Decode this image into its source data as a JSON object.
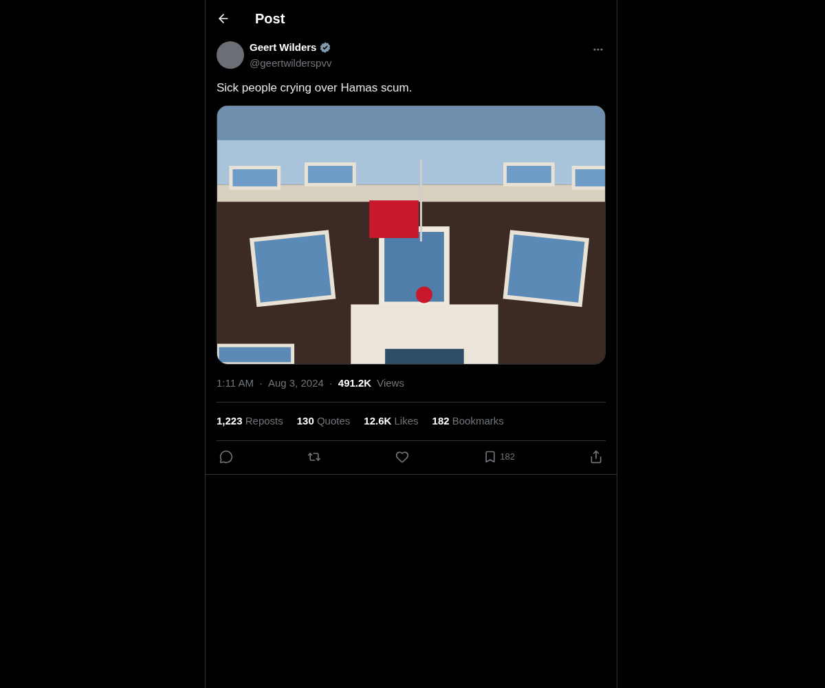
{
  "header": {
    "title": "Post"
  },
  "post": {
    "author": {
      "name": "Geert Wilders",
      "verified": true,
      "handle": "@geertwilderspvv"
    },
    "text": "Sick people crying over Hamas scum.",
    "time": "1:11 AM",
    "separator": "·",
    "date": "Aug 3, 2024",
    "views_count": "491.2K",
    "views_label": "Views",
    "stats": [
      {
        "count": "1,223",
        "label": "Reposts"
      },
      {
        "count": "130",
        "label": "Quotes"
      },
      {
        "count": "12.6K",
        "label": "Likes"
      },
      {
        "count": "182",
        "label": "Bookmarks"
      }
    ],
    "actions": [
      {
        "kind": "reply"
      },
      {
        "kind": "repost"
      },
      {
        "kind": "like"
      },
      {
        "kind": "bookmark",
        "count": "182"
      },
      {
        "kind": "share"
      }
    ]
  }
}
